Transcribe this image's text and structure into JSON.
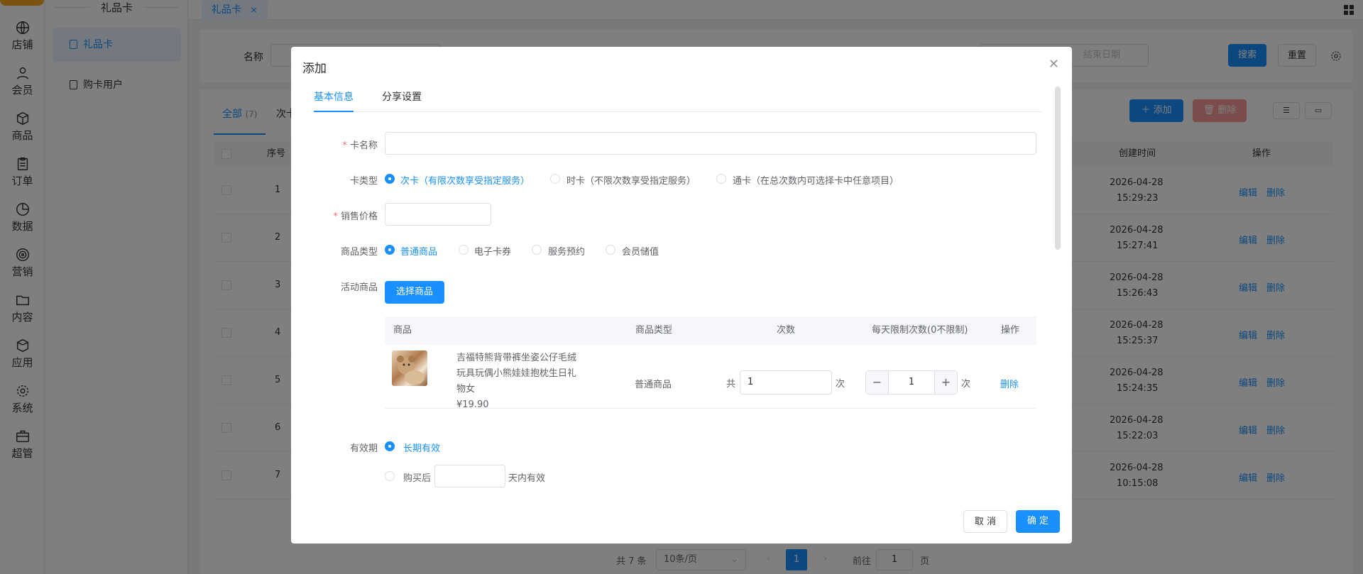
{
  "rail": {
    "items": [
      {
        "label": "店铺",
        "icon": "store-icon"
      },
      {
        "label": "会员",
        "icon": "user-icon"
      },
      {
        "label": "商品",
        "icon": "box-icon"
      },
      {
        "label": "订单",
        "icon": "clipboard-icon"
      },
      {
        "label": "数据",
        "icon": "pie-chart-icon"
      },
      {
        "label": "营销",
        "icon": "target-icon"
      },
      {
        "label": "内容",
        "icon": "folder-icon"
      },
      {
        "label": "应用",
        "icon": "cube-icon"
      },
      {
        "label": "系统",
        "icon": "gear-icon"
      },
      {
        "label": "超管",
        "icon": "briefcase-icon"
      }
    ]
  },
  "submenu": {
    "title": "礼品卡",
    "items": [
      {
        "label": "礼品卡"
      },
      {
        "label": "购卡用户"
      }
    ]
  },
  "top_tabs": [
    {
      "label": "礼品卡",
      "close": "×"
    }
  ],
  "filters": {
    "name_label": "名称",
    "end_date_placeholder": "结束日期",
    "search_label": "搜索",
    "reset_label": "重置"
  },
  "list": {
    "tab_all": "全部",
    "tab_all_count": "(7)",
    "tab_second": "次卡",
    "add_label": "添加",
    "delete_label": "删除",
    "columns": {
      "index": "序号",
      "created": "创建时间",
      "actions": "操作"
    },
    "rows": [
      {
        "index": "1",
        "date": "2026-04-28",
        "time": "15:29:23"
      },
      {
        "index": "2",
        "date": "2026-04-28",
        "time": "15:27:41"
      },
      {
        "index": "3",
        "date": "2026-04-28",
        "time": "15:26:43"
      },
      {
        "index": "4",
        "date": "2026-04-28",
        "time": "15:25:37"
      },
      {
        "index": "5",
        "date": "2026-04-28",
        "time": "15:24:35"
      },
      {
        "index": "6",
        "date": "2026-04-28",
        "time": "15:22:03"
      },
      {
        "index": "7",
        "date": "2026-04-28",
        "time": "10:15:08"
      }
    ],
    "edit_label": "编辑",
    "row_delete_label": "删除"
  },
  "pagination": {
    "total": "共 7 条",
    "page_size": "10条/页",
    "current": "1",
    "goto_label": "前往",
    "goto_value": "1",
    "page_suffix": "页"
  },
  "modal": {
    "title": "添加",
    "tabs": [
      "基本信息",
      "分享设置"
    ],
    "card_name_label": "卡名称",
    "card_type_label": "卡类型",
    "card_types": [
      {
        "label": "次卡（有限次数享受指定服务）",
        "selected": true
      },
      {
        "label": "时卡（不限次数享受指定服务）",
        "selected": false
      },
      {
        "label": "通卡（在总次数内可选择卡中任意项目）",
        "selected": false
      }
    ],
    "price_label": "销售价格",
    "goods_type_label": "商品类型",
    "goods_types": [
      {
        "label": "普通商品",
        "selected": true
      },
      {
        "label": "电子卡券",
        "selected": false
      },
      {
        "label": "服务预约",
        "selected": false
      },
      {
        "label": "会员储值",
        "selected": false
      }
    ],
    "activity_label": "活动商品",
    "select_goods_label": "选择商品",
    "goods_table": {
      "headers": [
        "商品",
        "商品类型",
        "次数",
        "每天限制次数(0不限制)",
        "操作"
      ],
      "row": {
        "name_line1": "吉福特熊背带裤坐姿公仔毛绒",
        "name_line2": "玩具玩偶小熊娃娃抱枕生日礼",
        "name_line3": "物女",
        "price": "¥19.90",
        "type": "普通商品",
        "count_prefix": "共",
        "count_value": "1",
        "count_suffix": "次",
        "daily_value": "1",
        "daily_suffix": "次",
        "action": "删除"
      }
    },
    "validity_label": "有效期",
    "validity_long": "长期有效",
    "validity_after_prefix": "购买后",
    "validity_after_suffix": "天内有效",
    "cancel_label": "取 消",
    "ok_label": "确 定"
  }
}
